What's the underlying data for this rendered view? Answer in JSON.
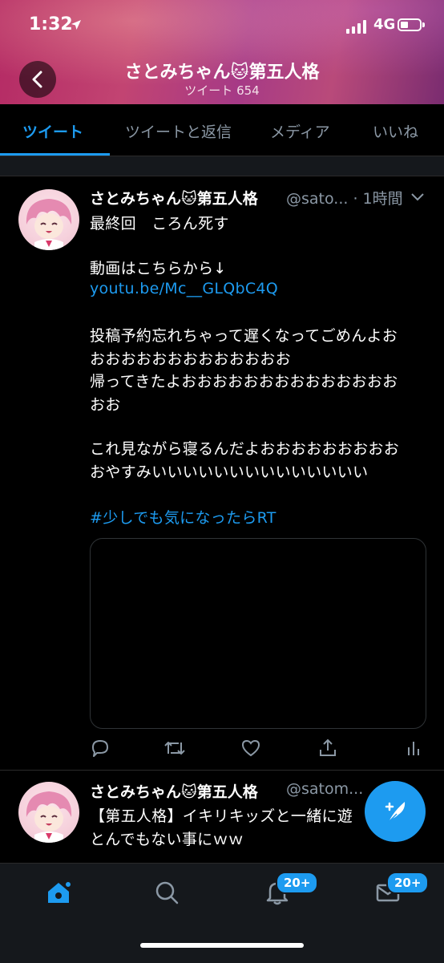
{
  "status_bar": {
    "time": "1:32",
    "network": "4G"
  },
  "header": {
    "title": "さとみちゃん🐱第五人格",
    "subtitle": "ツイート 654"
  },
  "tabs": [
    {
      "label": "ツイート"
    },
    {
      "label": "ツイートと返信"
    },
    {
      "label": "メディア"
    },
    {
      "label": "いいね"
    }
  ],
  "tweets": [
    {
      "name": "さとみちゃん🐱第五人格",
      "handle_time": "@sato... · 1時間",
      "lines": [
        "最終回　ころん死す",
        "",
        "動画はこちらから↓",
        "youtu.be/Mc__GLQbC4Q",
        "",
        "投稿予約忘れちゃって遅くなってごめんよお",
        "おおおおおおおおおおおおお",
        "帰ってきたよおおおおおおおおおおおおおお",
        "おお",
        "",
        "これ見ながら寝るんだよおおおおおおおおお",
        "おやすみいいいいいいいいいいいいいい",
        "",
        "#少しでも気になったらRT"
      ]
    },
    {
      "name": "さとみちゃん🐱第五人格",
      "handle_time": "@satom...",
      "lines": [
        "【第五人格】イキリキッズと一緒に遊",
        "とんでもない事にｗｗ"
      ]
    }
  ],
  "bottom_nav": {
    "notifications_badge": "20+",
    "messages_badge": "20+"
  },
  "colors": {
    "accent": "#1d9bf0",
    "background": "#000000",
    "secondary_text": "#8b98a5"
  }
}
